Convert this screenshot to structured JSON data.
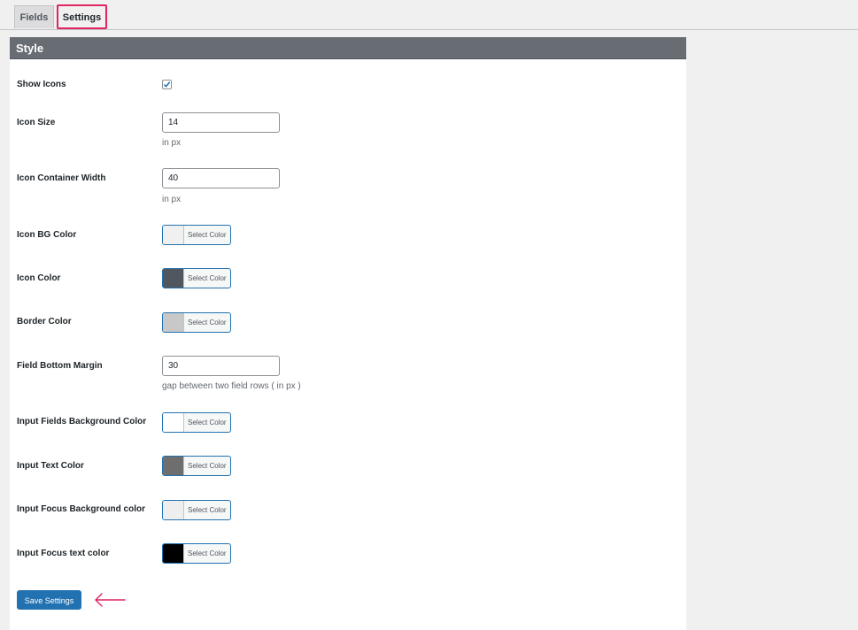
{
  "tabs": [
    {
      "label": "Fields",
      "active": false
    },
    {
      "label": "Settings",
      "active": true
    }
  ],
  "section": {
    "title": "Style"
  },
  "fields": {
    "show_icons": {
      "label": "Show Icons",
      "checked": true
    },
    "icon_size": {
      "label": "Icon Size",
      "value": "14",
      "hint": "in px"
    },
    "icon_container_width": {
      "label": "Icon Container Width",
      "value": "40",
      "hint": "in px"
    },
    "icon_bg_color": {
      "label": "Icon BG Color",
      "swatch": "#f0f0f1",
      "button_label": "Select Color"
    },
    "icon_color": {
      "label": "Icon Color",
      "swatch": "#50575e",
      "button_label": "Select Color"
    },
    "border_color": {
      "label": "Border Color",
      "swatch": "#c8c8c8",
      "button_label": "Select Color"
    },
    "field_bottom_margin": {
      "label": "Field Bottom Margin",
      "value": "30",
      "hint": "gap between two field rows ( in px )"
    },
    "input_fields_bg_color": {
      "label": "Input Fields Background Color",
      "swatch": "#ffffff",
      "button_label": "Select Color"
    },
    "input_text_color": {
      "label": "Input Text Color",
      "swatch": "#6e6e6e",
      "button_label": "Select Color"
    },
    "input_focus_bg_color": {
      "label": "Input Focus Background color",
      "swatch": "#eeeeee",
      "button_label": "Select Color"
    },
    "input_focus_text_color": {
      "label": "Input Focus text color",
      "swatch": "#000000",
      "button_label": "Select Color"
    }
  },
  "actions": {
    "save_label": "Save Settings"
  },
  "colors": {
    "accent": "#2271b1",
    "highlight": "#e0245e",
    "header_bg": "#686d73"
  }
}
